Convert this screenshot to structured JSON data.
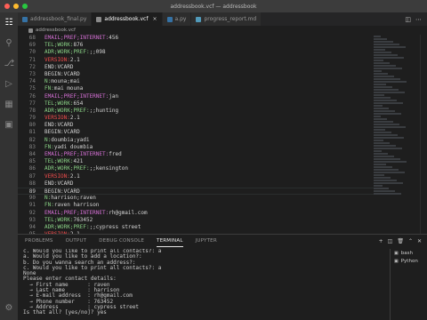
{
  "window": {
    "title": "addressbook.vcf — addressbook"
  },
  "tabs": [
    {
      "label": "addressbook_final.py",
      "icon": "python-icon",
      "active": false
    },
    {
      "label": "addressbook.vcf",
      "icon": "file-icon",
      "active": true
    },
    {
      "label": "a.py",
      "icon": "python-icon",
      "active": false
    },
    {
      "label": "progress_report.md",
      "icon": "markdown-icon",
      "active": false
    }
  ],
  "breadcrumb": {
    "file": "addressbook.vcf"
  },
  "editor": {
    "lines": [
      {
        "n": "68",
        "parts": [
          [
            "EMAIL;PREF;INTERNET:",
            "pink"
          ],
          [
            "456",
            "white"
          ]
        ]
      },
      {
        "n": "69",
        "parts": [
          [
            "TEL;WORK:",
            "green"
          ],
          [
            "876",
            "white"
          ]
        ]
      },
      {
        "n": "70",
        "parts": [
          [
            "ADR;WORK;PREF:",
            "green"
          ],
          [
            ";;098",
            "white"
          ]
        ]
      },
      {
        "n": "71",
        "parts": [
          [
            "VERSION:",
            "red"
          ],
          [
            "2.1",
            "white"
          ]
        ]
      },
      {
        "n": "72",
        "parts": [
          [
            "END:VCARD",
            "white"
          ]
        ]
      },
      {
        "n": "73",
        "parts": [
          [
            "BEGIN:VCARD",
            "white"
          ]
        ]
      },
      {
        "n": "74",
        "parts": [
          [
            "N:",
            "green"
          ],
          [
            "mouna;mai",
            "white"
          ]
        ]
      },
      {
        "n": "75",
        "parts": [
          [
            "FN:",
            "green"
          ],
          [
            "mai mouna",
            "white"
          ]
        ]
      },
      {
        "n": "76",
        "parts": [
          [
            "EMAIL;PREF;INTERNET:",
            "pink"
          ],
          [
            "jan",
            "white"
          ]
        ]
      },
      {
        "n": "77",
        "parts": [
          [
            "TEL;WORK:",
            "green"
          ],
          [
            "654",
            "white"
          ]
        ]
      },
      {
        "n": "78",
        "parts": [
          [
            "ADR;WORK;PREF:",
            "green"
          ],
          [
            ";;hunting",
            "white"
          ]
        ]
      },
      {
        "n": "79",
        "parts": [
          [
            "VERSION:",
            "red"
          ],
          [
            "2.1",
            "white"
          ]
        ]
      },
      {
        "n": "80",
        "parts": [
          [
            "END:VCARD",
            "white"
          ]
        ]
      },
      {
        "n": "81",
        "parts": [
          [
            "BEGIN:VCARD",
            "white"
          ]
        ]
      },
      {
        "n": "82",
        "parts": [
          [
            "N:",
            "green"
          ],
          [
            "doumbia;yadi",
            "white"
          ]
        ]
      },
      {
        "n": "83",
        "parts": [
          [
            "FN:",
            "green"
          ],
          [
            "yadi doumbia",
            "white"
          ]
        ]
      },
      {
        "n": "84",
        "parts": [
          [
            "EMAIL;PREF;INTERNET:",
            "pink"
          ],
          [
            "fred",
            "white"
          ]
        ]
      },
      {
        "n": "85",
        "parts": [
          [
            "TEL;WORK:",
            "green"
          ],
          [
            "421",
            "white"
          ]
        ]
      },
      {
        "n": "86",
        "parts": [
          [
            "ADR;WORK;PREF:",
            "green"
          ],
          [
            ";;kensington",
            "white"
          ]
        ]
      },
      {
        "n": "87",
        "parts": [
          [
            "VERSION:",
            "red"
          ],
          [
            "2.1",
            "white"
          ]
        ]
      },
      {
        "n": "88",
        "parts": [
          [
            "END:VCARD",
            "white"
          ]
        ]
      },
      {
        "n": "89",
        "parts": [
          [
            "BEGIN:VCARD",
            "white"
          ]
        ],
        "current": true
      },
      {
        "n": "90",
        "parts": [
          [
            "N:",
            "green"
          ],
          [
            "harrison;raven",
            "white"
          ]
        ]
      },
      {
        "n": "91",
        "parts": [
          [
            "FN:",
            "green"
          ],
          [
            "raven harrison",
            "white"
          ]
        ]
      },
      {
        "n": "92",
        "parts": [
          [
            "EMAIL;PREF;INTERNET:",
            "pink"
          ],
          [
            "rh@gmail.com",
            "white"
          ]
        ]
      },
      {
        "n": "93",
        "parts": [
          [
            "TEL;WORK:",
            "green"
          ],
          [
            "763452",
            "white"
          ]
        ]
      },
      {
        "n": "94",
        "parts": [
          [
            "ADR;WORK;PREF:",
            "green"
          ],
          [
            ";;cypress street",
            "white"
          ]
        ]
      },
      {
        "n": "95",
        "parts": [
          [
            "VERSION:",
            "red"
          ],
          [
            "2.1",
            "white"
          ]
        ]
      }
    ]
  },
  "panel": {
    "tabs": [
      "PROBLEMS",
      "OUTPUT",
      "DEBUG CONSOLE",
      "TERMINAL",
      "JUPYTER"
    ],
    "active_tab": "TERMINAL",
    "terminal_lines": [
      "c. Would you like to print all contacts?: a",
      "a. Would you like to add a location?:",
      "b. Do you wanna search an address?:",
      "c. Would you like to print all contacts?: a",
      "None",
      "Please enter contact details:",
      "  → First name      : raven",
      "  → Last name       : harrison",
      "  → E-mail address  : rh@gmail.com",
      "  → Phone number    : 763452",
      "  → Address         : cypress street",
      "Is that all? [yes/no]? yes"
    ],
    "terminals": [
      {
        "label": "bash",
        "icon": "terminal-icon"
      },
      {
        "label": "Python",
        "icon": "terminal-icon"
      }
    ]
  },
  "colors": {
    "green": "#89d185",
    "pink": "#d670d6",
    "red": "#f14c4c",
    "white": "#d4d4d4",
    "background": "#1e1e1e",
    "activity_bar": "#333333"
  }
}
